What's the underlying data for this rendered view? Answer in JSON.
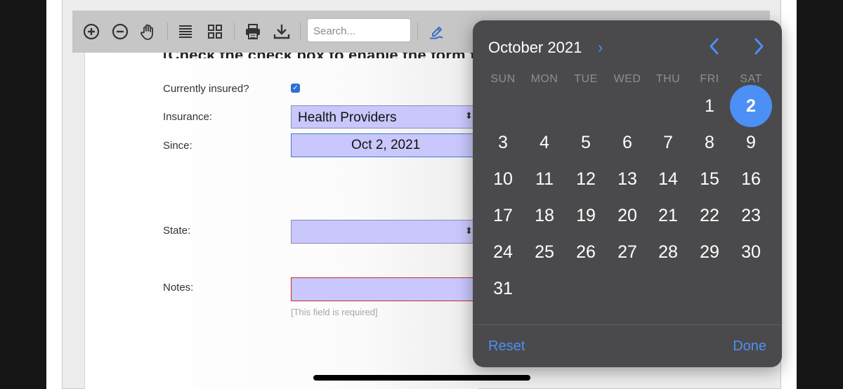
{
  "toolbar": {
    "buttons": [
      {
        "name": "zoom-in-button",
        "icon": "zoom-in-icon"
      },
      {
        "name": "zoom-out-button",
        "icon": "zoom-out-icon"
      },
      {
        "name": "pan-tool-button",
        "icon": "hand-icon"
      },
      {
        "name": "text-view-button",
        "icon": "lines-icon"
      },
      {
        "name": "thumbnails-button",
        "icon": "grid-icon"
      },
      {
        "name": "print-button",
        "icon": "printer-icon"
      },
      {
        "name": "download-button",
        "icon": "download-icon"
      },
      {
        "name": "annotate-button",
        "icon": "pen-icon"
      }
    ],
    "search_placeholder": "Search..."
  },
  "form": {
    "heading_partial": "[Check the check box to enable the form f",
    "currently_insured_label": "Currently insured?",
    "currently_insured_checked": true,
    "insurance_label": "Insurance:",
    "insurance_value": "Health Providers",
    "since_label": "Since:",
    "since_value": "Oct 2, 2021",
    "state_label": "State:",
    "state_value": "",
    "notes_label": "Notes:",
    "notes_value": "",
    "notes_hint": "[This field is required]"
  },
  "date_picker": {
    "month_year": "October 2021",
    "weekdays": [
      "SUN",
      "MON",
      "TUE",
      "WED",
      "THU",
      "FRI",
      "SAT"
    ],
    "first_weekday_index": 5,
    "days_in_month": 31,
    "selected_day": 2,
    "reset_label": "Reset",
    "done_label": "Done",
    "accent_color": "#4c8ff5"
  }
}
